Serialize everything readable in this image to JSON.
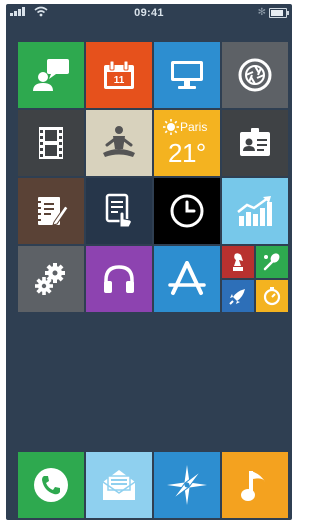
{
  "status_bar": {
    "time": "09:41",
    "bluetooth": "✻",
    "battery_level": 0.85
  },
  "tiles": [
    {
      "id": "messages",
      "color": "#2ea94f",
      "icon": "chat-user-icon"
    },
    {
      "id": "calendar",
      "color": "#e6511c",
      "icon": "calendar-icon",
      "text": "11"
    },
    {
      "id": "desktop",
      "color": "#2d8ed0",
      "icon": "monitor-icon"
    },
    {
      "id": "camera",
      "color": "#5d6166",
      "icon": "aperture-icon"
    },
    {
      "id": "video",
      "color": "#3f4245",
      "icon": "film-icon"
    },
    {
      "id": "meditation",
      "color": "#d8d2bd",
      "icon": "meditation-icon"
    },
    {
      "id": "weather",
      "color": "#f4b320",
      "icon": "weather-icon",
      "city": "Paris",
      "temp": "21°"
    },
    {
      "id": "contacts",
      "color": "#3f4245",
      "icon": "id-card-icon"
    },
    {
      "id": "notes",
      "color": "#5a4236",
      "icon": "notebook-icon"
    },
    {
      "id": "documents",
      "color": "#26364a",
      "icon": "document-touch-icon"
    },
    {
      "id": "clock",
      "color": "#000000",
      "icon": "clock-icon"
    },
    {
      "id": "stocks",
      "color": "#77c8ea",
      "icon": "chart-up-icon"
    },
    {
      "id": "settings",
      "color": "#5d6166",
      "icon": "gears-icon"
    },
    {
      "id": "music-player",
      "color": "#8d43b0",
      "icon": "headphones-icon"
    },
    {
      "id": "app-store",
      "color": "#2d8ed0",
      "icon": "app-store-icon"
    },
    {
      "id": "games-group",
      "icon": "folder-icon",
      "minis": [
        {
          "id": "chess",
          "color": "#b8312f",
          "icon": "chess-piece-icon"
        },
        {
          "id": "sports",
          "color": "#2ea94f",
          "icon": "racket-icon"
        },
        {
          "id": "rocket",
          "color": "#2d6fb8",
          "icon": "rocket-icon"
        },
        {
          "id": "timer",
          "color": "#f4b320",
          "icon": "stopwatch-icon"
        }
      ]
    }
  ],
  "dock": [
    {
      "id": "phone",
      "color": "#2ea94f",
      "icon": "phone-icon"
    },
    {
      "id": "mail",
      "color": "#8fd0ef",
      "icon": "mail-icon"
    },
    {
      "id": "safari",
      "color": "#2d8ed0",
      "icon": "compass-icon"
    },
    {
      "id": "music",
      "color": "#f4a21f",
      "icon": "music-note-icon"
    }
  ]
}
